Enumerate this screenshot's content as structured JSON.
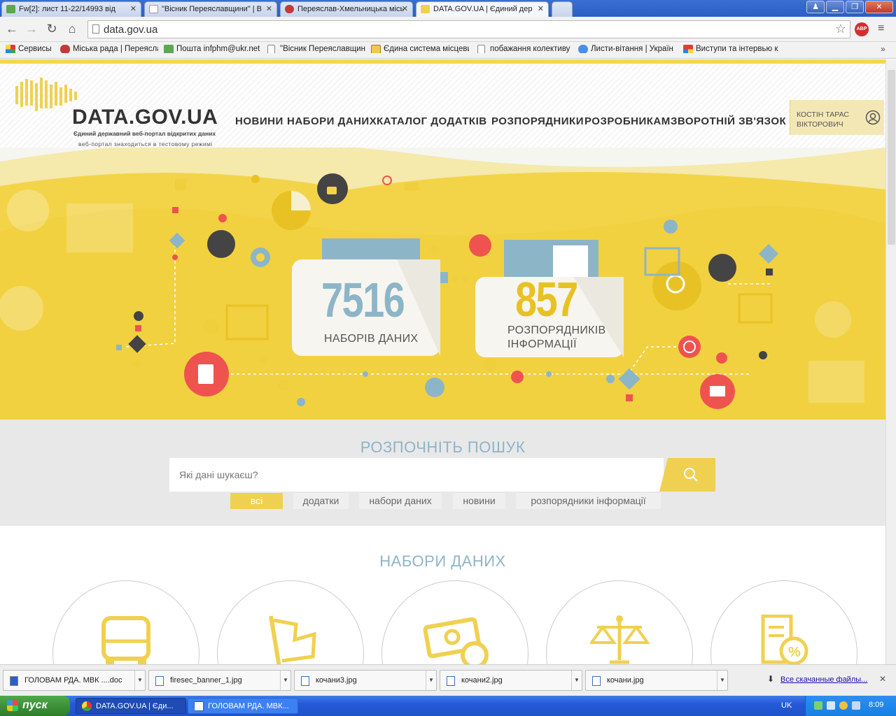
{
  "browser": {
    "tabs": [
      {
        "label": "Fw[2]: лист 11-22/14993 від",
        "active": false
      },
      {
        "label": "\"Вісник Переяславщини\" | В",
        "active": false
      },
      {
        "label": "Переяслав-Хмельницька місь",
        "active": false
      },
      {
        "label": "DATA.GOV.UA | Єдиний дер",
        "active": true
      }
    ],
    "url": "data.gov.ua",
    "abp_label": "ABP",
    "bookmarks": [
      "Сервисы",
      "Міська рада | Переясла",
      "Пошта infphm@ukr.net",
      "\"Вісник Переяславщин",
      "Єдина система місцеви",
      "побажання колективу",
      "Листи-вітання | Україн",
      "Виступи та інтервью к"
    ]
  },
  "site": {
    "logo": "DATA.GOV.UA",
    "tagline": "Єдиний державний веб-портал відкритих даних",
    "test_mode": "веб-портал знаходиться в тестовому режимі",
    "menu": [
      "НОВИНИ",
      "НАБОРИ ДАНИХ",
      "КАТАЛОГ ДОДАТКІВ",
      "РОЗПОРЯДНИКИ",
      "РОЗРОБНИКАМ",
      "ЗВОРОТНІЙ ЗВ'ЯЗОК"
    ],
    "user_name": "КОСТІН ТАРАС ВІКТОРОВИЧ"
  },
  "hero": {
    "datasets_count": "7516",
    "datasets_label": "НАБОРІВ ДАНИХ",
    "publishers_count": "857",
    "publishers_label_1": "РОЗПОРЯДНИКІВ",
    "publishers_label_2": "ІНФОРМАЦІЇ"
  },
  "search": {
    "title": "РОЗПОЧНІТЬ ПОШУК",
    "placeholder": "Які дані шукаєш?",
    "filters": [
      "всі",
      "додатки",
      "набори даних",
      "новини",
      "розпорядники інформації"
    ],
    "active_filter": "всі"
  },
  "datasets": {
    "title": "НАБОРИ ДАНИХ",
    "category_icons": [
      "bus-icon",
      "flag-icon",
      "money-icon",
      "scales-icon",
      "document-percent-icon"
    ]
  },
  "downloads": {
    "items": [
      "ГОЛОВАМ РДА. МВК ....doc",
      "firesec_banner_1.jpg",
      "кочани3.jpg",
      "кочани2.jpg",
      "кочани.jpg"
    ],
    "all_link": "Все скачанные файлы..."
  },
  "taskbar": {
    "start": "пуск",
    "windows": [
      "DATA.GOV.UA | Єди...",
      "ГОЛОВАМ РДА. МВК..."
    ],
    "lang": "UK",
    "time": "8:09"
  },
  "colors": {
    "accent_yellow": "#f3d448",
    "blue_num": "#8db5c8",
    "red": "#ef5350"
  }
}
